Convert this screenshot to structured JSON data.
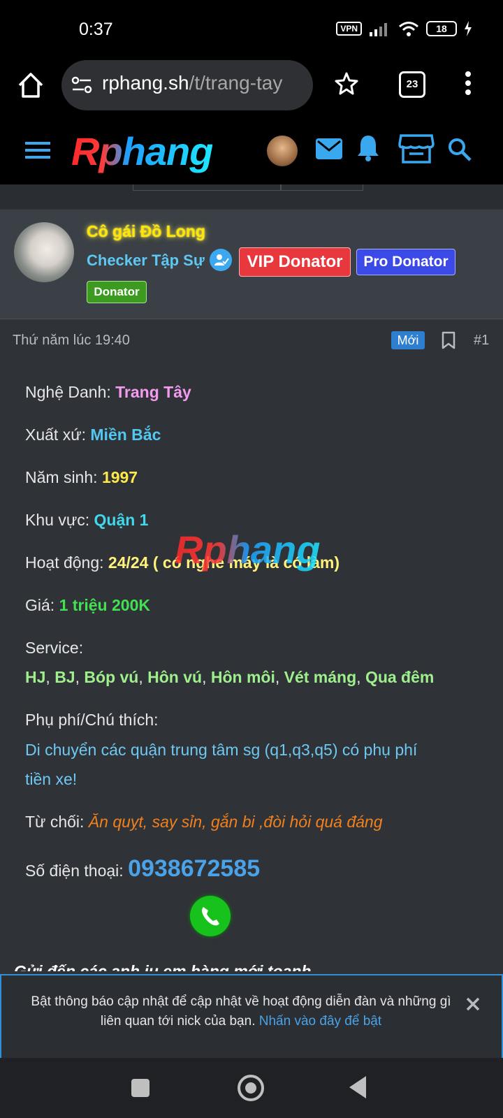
{
  "status": {
    "time": "0:37",
    "vpn": "VPN",
    "battery": "18"
  },
  "browser": {
    "url_host": "rphang.sh",
    "url_path": "/t/trang-tay",
    "tab_count": "23"
  },
  "site": {
    "logo": "Rphang"
  },
  "user": {
    "name": "Cô gái Đồ Long",
    "title": "Checker Tập Sự",
    "badges": [
      "VIP Donator",
      "Pro Donator",
      "Donator"
    ]
  },
  "post": {
    "date": "Thứ năm lúc 19:40",
    "new_label": "Mới",
    "number": "#1",
    "fields": {
      "stage_name_label": "Nghệ Danh:",
      "stage_name": "Trang Tây",
      "origin_label": "Xuất xứ:",
      "origin": "Miền Bắc",
      "birth_label": "Năm sinh:",
      "birth": "1997",
      "area_label": "Khu vực:",
      "area": "Quận 1",
      "activity_label": "Hoạt động:",
      "activity": "24/24 ( có nghe máy là có làm)",
      "price_label": "Giá:",
      "price": "1 triệu 200K",
      "service_label": "Service:",
      "services": [
        "HJ",
        "BJ",
        "Bóp vú",
        "Hôn vú",
        "Hôn môi",
        "Vét máng",
        "Qua đêm"
      ],
      "fee_label": "Phụ phí/Chú thích:",
      "fee_line1": "Di chuyển các quận trung tâm sg (q1,q3,q5) có phụ phí",
      "fee_line2": "tiền xe!",
      "refuse_label": "Từ chối:",
      "refuse": "Ăn quỵt, say sỉn, gắn bi ,đòi hỏi quá đáng",
      "phone_label": "Số điện thoại:",
      "phone": "0938672585"
    },
    "watermark": "Rphang",
    "clipped_text": "Gửi đến các anh iu em hàng mới toanh"
  },
  "notice": {
    "text": "Bật thông báo cập nhật để cập nhật về hoạt động diễn đàn và những gì liên quan tới nick của bạn.",
    "link": "Nhấn vào đây để bật"
  },
  "colors": {
    "accent": "#2f8fd8",
    "vip": "#e8383d",
    "pro": "#3b49e6",
    "donator": "#3b9a1f"
  }
}
